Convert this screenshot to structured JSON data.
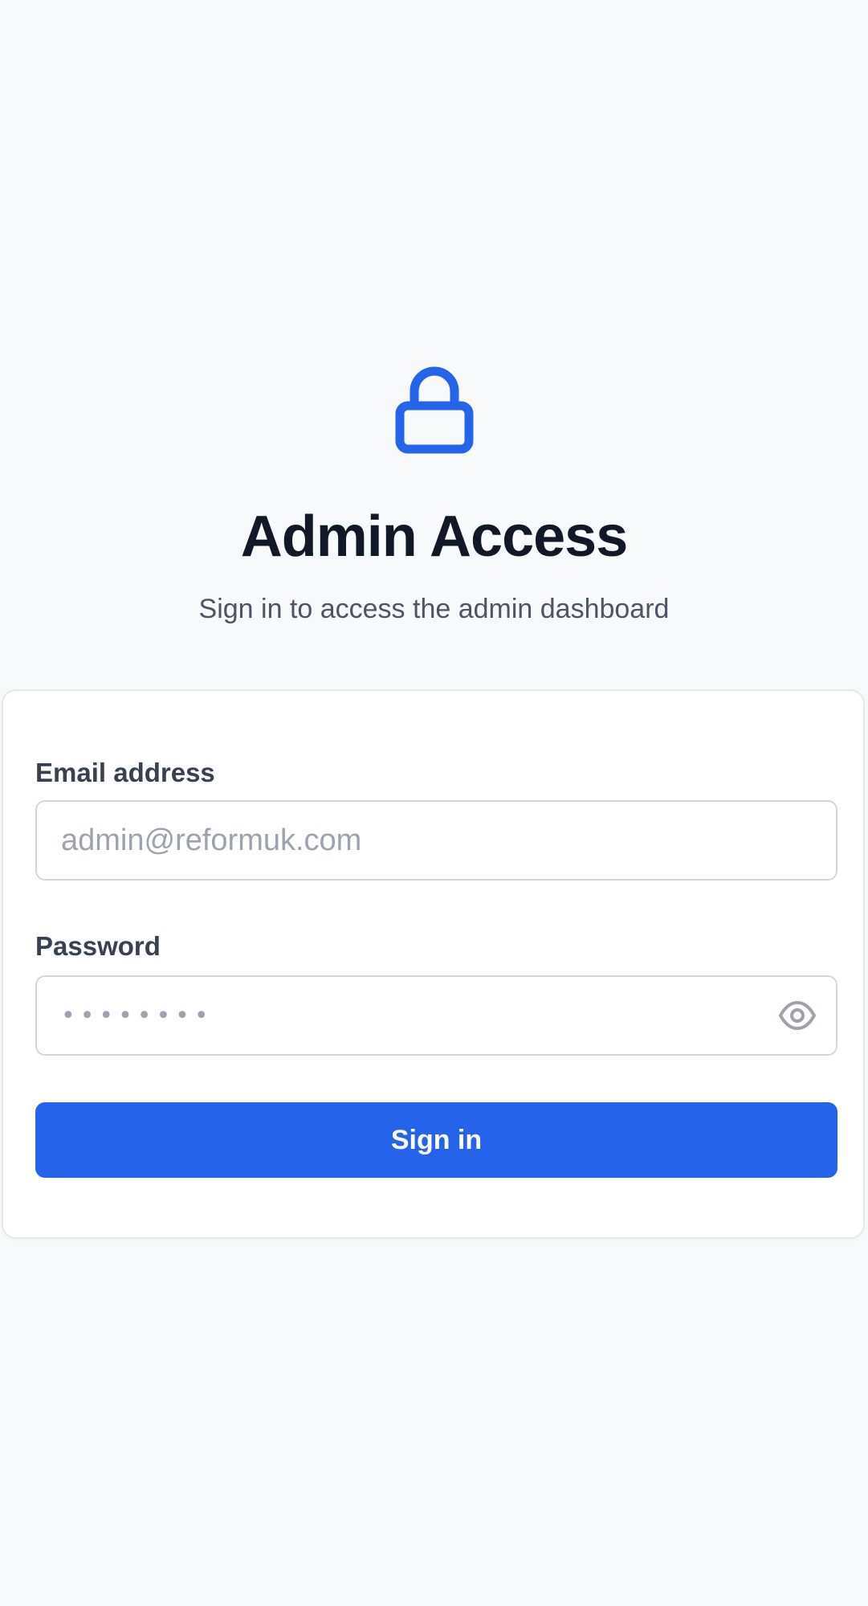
{
  "header": {
    "icon": "lock-icon",
    "title": "Admin Access",
    "subtitle": "Sign in to access the admin dashboard"
  },
  "form": {
    "email_label": "Email address",
    "email_placeholder": "admin@reformuk.com",
    "email_value": "",
    "password_label": "Password",
    "password_placeholder": "••••••••",
    "password_value": "",
    "toggle_icon": "eye-icon",
    "submit_label": "Sign in"
  },
  "colors": {
    "accent": "#2563eb",
    "background": "#f8f9fb",
    "card": "#ffffff",
    "title": "#111827",
    "subtitle": "#4b5563",
    "placeholder": "#9ca3af"
  }
}
